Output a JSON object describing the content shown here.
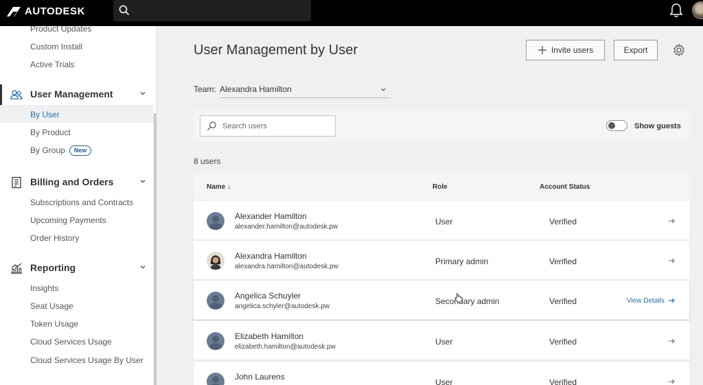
{
  "topbar": {
    "brand": "AUTODESK"
  },
  "sidebar": {
    "top_items": [
      {
        "label": "Product Updates"
      },
      {
        "label": "Custom Install"
      },
      {
        "label": "Active Trials"
      }
    ],
    "sections": [
      {
        "label": "User Management",
        "icon": "users-icon",
        "items": [
          {
            "label": "By User"
          },
          {
            "label": "By Product"
          },
          {
            "label": "By Group",
            "badge": "New"
          }
        ]
      },
      {
        "label": "Billing and Orders",
        "icon": "receipt-icon",
        "items": [
          {
            "label": "Subscriptions and Contracts"
          },
          {
            "label": "Upcoming Payments"
          },
          {
            "label": "Order History"
          }
        ]
      },
      {
        "label": "Reporting",
        "icon": "chart-icon",
        "items": [
          {
            "label": "Insights"
          },
          {
            "label": "Seat Usage"
          },
          {
            "label": "Token Usage"
          },
          {
            "label": "Cloud Services Usage"
          },
          {
            "label": "Cloud Services Usage By User"
          }
        ]
      }
    ]
  },
  "main": {
    "title": "User Management by User",
    "invite_label": "Invite users",
    "export_label": "Export",
    "team_label": "Team:",
    "team_value": "Alexandra Hamilton",
    "search_placeholder": "Search users",
    "show_guests_label": "Show guests",
    "user_count": "8 users",
    "columns": {
      "name": "Name ↓",
      "role": "Role",
      "status": "Account Status"
    },
    "view_details_label": "View Details",
    "users": [
      {
        "name": "Alexander Hamilton",
        "email": "alexander.hamilton@autodesk.pw",
        "role": "User",
        "status": "Verified"
      },
      {
        "name": "Alexandra Hamilton",
        "email": "alexandra.hamilton@autodesk.pw",
        "role": "Primary admin",
        "status": "Verified"
      },
      {
        "name": "Angelica Schuyler",
        "email": "angelica.schyler@autodesk.pw",
        "role": "Secondary admin",
        "status": "Verified"
      },
      {
        "name": "Elizabeth Hamilton",
        "email": "elizabeth.hamilton@autodesk.pw",
        "role": "User",
        "status": "Verified"
      },
      {
        "name": "John Laurens",
        "email": "",
        "role": "User",
        "status": "Verified"
      }
    ]
  },
  "colors": {
    "topbar": "#000000",
    "link": "#2a6fa8",
    "avatar_default": "#6a7d93"
  }
}
